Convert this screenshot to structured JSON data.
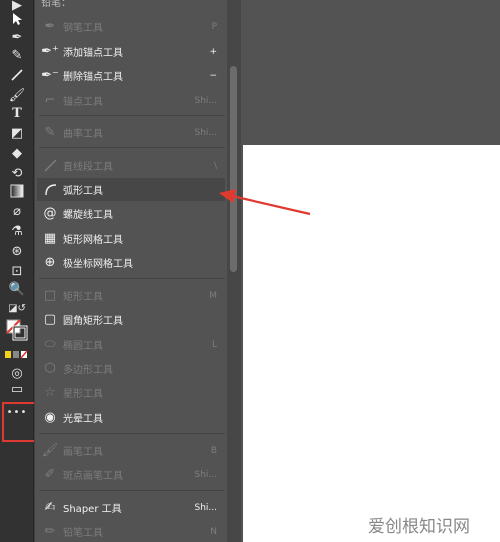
{
  "panel": {
    "header_text": "铅笔：",
    "items": [
      {
        "label": "钢笔工具",
        "shortcut": "P",
        "enabled": false
      },
      {
        "label": "添加锚点工具",
        "shortcut": "+",
        "enabled": true
      },
      {
        "label": "删除锚点工具",
        "shortcut": "−",
        "enabled": true
      },
      {
        "label": "锚点工具",
        "shortcut": "Shi...",
        "enabled": false
      },
      {
        "label": "曲率工具",
        "shortcut": "Shi...",
        "enabled": false
      },
      {
        "label": "直线段工具",
        "shortcut": "\\",
        "enabled": false
      },
      {
        "label": "弧形工具",
        "shortcut": "",
        "enabled": true,
        "selected": true
      },
      {
        "label": "螺旋线工具",
        "shortcut": "",
        "enabled": true
      },
      {
        "label": "矩形网格工具",
        "shortcut": "",
        "enabled": true
      },
      {
        "label": "极坐标网格工具",
        "shortcut": "",
        "enabled": true
      },
      {
        "label": "矩形工具",
        "shortcut": "M",
        "enabled": false
      },
      {
        "label": "圆角矩形工具",
        "shortcut": "",
        "enabled": true
      },
      {
        "label": "椭圆工具",
        "shortcut": "L",
        "enabled": false
      },
      {
        "label": "多边形工具",
        "shortcut": "",
        "enabled": false
      },
      {
        "label": "星形工具",
        "shortcut": "",
        "enabled": false
      },
      {
        "label": "光晕工具",
        "shortcut": "",
        "enabled": true
      },
      {
        "label": "画笔工具",
        "shortcut": "B",
        "enabled": false
      },
      {
        "label": "斑点画笔工具",
        "shortcut": "Shi...",
        "enabled": false
      },
      {
        "label": "Shaper 工具",
        "shortcut": "Shi...",
        "enabled": true
      },
      {
        "label": "铅笔工具",
        "shortcut": "N",
        "enabled": false
      }
    ]
  },
  "toolbar": {
    "more_label": "•••"
  },
  "watermark": "爱创根知识网",
  "colors": {
    "annotation_red": "#e03a30",
    "panel_bg": "#535353",
    "toolbar_bg": "#323232",
    "artboard": "#ffffff"
  }
}
